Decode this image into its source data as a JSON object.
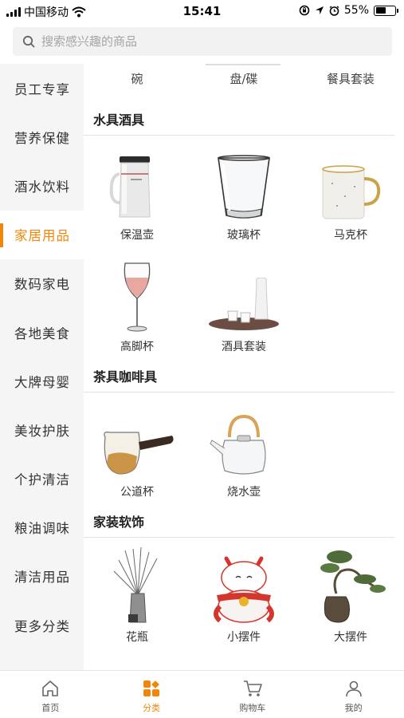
{
  "status_bar": {
    "carrier": "中国移动",
    "time": "15:41",
    "battery": "55%",
    "battery_level": 0.55
  },
  "search": {
    "placeholder": "搜索感兴趣的商品"
  },
  "sidebar": {
    "items": [
      {
        "label": "员工专享"
      },
      {
        "label": "营养保健"
      },
      {
        "label": "酒水饮料"
      },
      {
        "label": "家居用品",
        "active": true
      },
      {
        "label": "数码家电"
      },
      {
        "label": "各地美食"
      },
      {
        "label": "大牌母婴"
      },
      {
        "label": "美妆护肤"
      },
      {
        "label": "个护清洁"
      },
      {
        "label": "粮油调味"
      },
      {
        "label": "清洁用品"
      },
      {
        "label": "更多分类"
      }
    ]
  },
  "top_tabs": [
    "碗",
    "盘/碟",
    "餐具套装"
  ],
  "sections": [
    {
      "title": "水具酒具",
      "items": [
        "保温壶",
        "玻璃杯",
        "马克杯",
        "高脚杯",
        "酒具套装"
      ]
    },
    {
      "title": "茶具咖啡具",
      "items": [
        "公道杯",
        "烧水壶"
      ]
    },
    {
      "title": "家装软饰",
      "items": [
        "花瓶",
        "小摆件",
        "大摆件"
      ]
    }
  ],
  "tabbar": {
    "items": [
      {
        "label": "首页",
        "icon": "home-icon"
      },
      {
        "label": "分类",
        "icon": "category-icon",
        "active": true
      },
      {
        "label": "购物车",
        "icon": "cart-icon"
      },
      {
        "label": "我的",
        "icon": "user-icon"
      }
    ]
  },
  "colors": {
    "accent": "#f0870a",
    "sidebar_bg": "#f5f5f5"
  }
}
